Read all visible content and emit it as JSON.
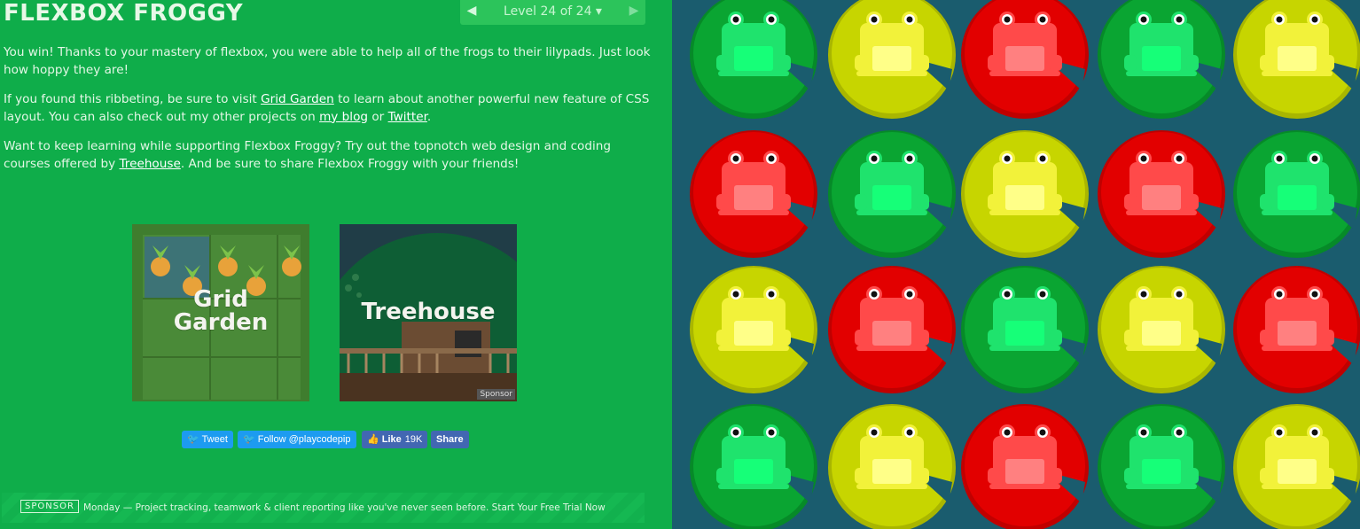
{
  "header": {
    "title": "FLEXBOX FROGGY",
    "level_label": "Level 24 of 24 ▾",
    "prev_arrow": "◀",
    "next_arrow": "▶"
  },
  "instructions": {
    "p1": "You win! Thanks to your mastery of flexbox, you were able to help all of the frogs to their lilypads. Just look how hoppy they are!",
    "p2_pre": "If you found this ribbeting, be sure to visit ",
    "p2_link1": "Grid Garden",
    "p2_mid1": " to learn about another powerful new feature of CSS layout. You can also check out my other projects on ",
    "p2_link2": "my blog",
    "p2_mid2": " or ",
    "p2_link3": "Twitter",
    "p2_end": ".",
    "p3_pre": "Want to keep learning while supporting Flexbox Froggy? Try out the topnotch web design and coding courses offered by ",
    "p3_link": "Treehouse",
    "p3_end": ". And be sure to share Flexbox Froggy with your friends!"
  },
  "cards": {
    "grid_garden_line1": "Grid",
    "grid_garden_line2": "Garden",
    "treehouse": "Treehouse",
    "sponsor_tag": "Sponsor"
  },
  "share": {
    "tweet": "Tweet",
    "follow": "Follow @playcodepip",
    "like": "Like",
    "like_count": "19K",
    "share": "Share"
  },
  "sponsor": {
    "badge": "SPONSOR",
    "text": "Monday — Project tracking, teamwork & client reporting like you've never seen before. Start Your Free Trial Now"
  },
  "board": {
    "rows": [
      [
        "green",
        "yellow",
        "red",
        "green",
        "yellow"
      ],
      [
        "red",
        "green",
        "yellow",
        "red",
        "green"
      ],
      [
        "yellow",
        "red",
        "green",
        "yellow",
        "red"
      ],
      [
        "green",
        "yellow",
        "red",
        "green",
        "yellow"
      ]
    ],
    "colors": {
      "green": {
        "pad": "#0aa532",
        "padDark": "#068a28",
        "frog": "#1fe36d",
        "belly": "#16ff78"
      },
      "yellow": {
        "pad": "#c7d500",
        "padDark": "#a9b600",
        "frog": "#f2f23a",
        "belly": "#ffff88"
      },
      "red": {
        "pad": "#e20000",
        "padDark": "#c00000",
        "frog": "#ff4a4a",
        "belly": "#ff8080"
      }
    }
  }
}
